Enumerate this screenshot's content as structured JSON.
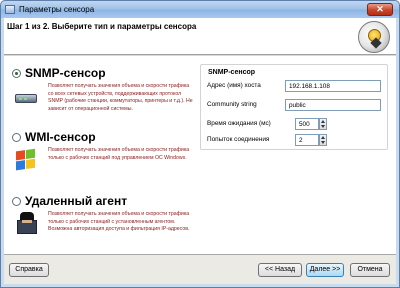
{
  "window": {
    "title": "Параметры сенсора",
    "close_glyph": "✕"
  },
  "header": {
    "step_text": "Шаг 1 из 2. Выберите тип и параметры сенсора"
  },
  "options": [
    {
      "label": "SNMP-сенсор",
      "selected": true,
      "icon": "router-icon",
      "description": "Позволяет получать значения объема и скорости трафика со всех сетевых устройств, поддерживающих протокол SNMP (рабочие станции, коммутаторы, принтеры и т.д.). Не зависит от операционной системы."
    },
    {
      "label": "WMI-сенсор",
      "selected": false,
      "icon": "windows-icon",
      "description": "Позволяет получать значения объема и скорости трафика только с рабочих станций под управлением ОС Windows."
    },
    {
      "label": "Удаленный агент",
      "selected": false,
      "icon": "agent-icon",
      "description": "Позволяет получать значения объема и скорости трафика только с рабочих станций с установленным агентом. Возможна авторизация доступа и фильтрация IP-адресов."
    }
  ],
  "snmp_panel": {
    "title": "SNMP-сенсор",
    "host_label": "Адрес (имя) хоста",
    "host_value": "192.168.1.108",
    "community_label": "Community string",
    "community_value": "public",
    "timeout_label": "Время ожидания (мс)",
    "timeout_value": "500",
    "retries_label": "Попыток соединения",
    "retries_value": "2"
  },
  "footer": {
    "help": "Справка",
    "back": "<< Назад",
    "next": "Далее >>",
    "cancel": "Отмена"
  },
  "colors": {
    "description_text": "#8b1a1a",
    "titlebar": "#9ec0e6",
    "footer_bg": "#eceae4"
  }
}
